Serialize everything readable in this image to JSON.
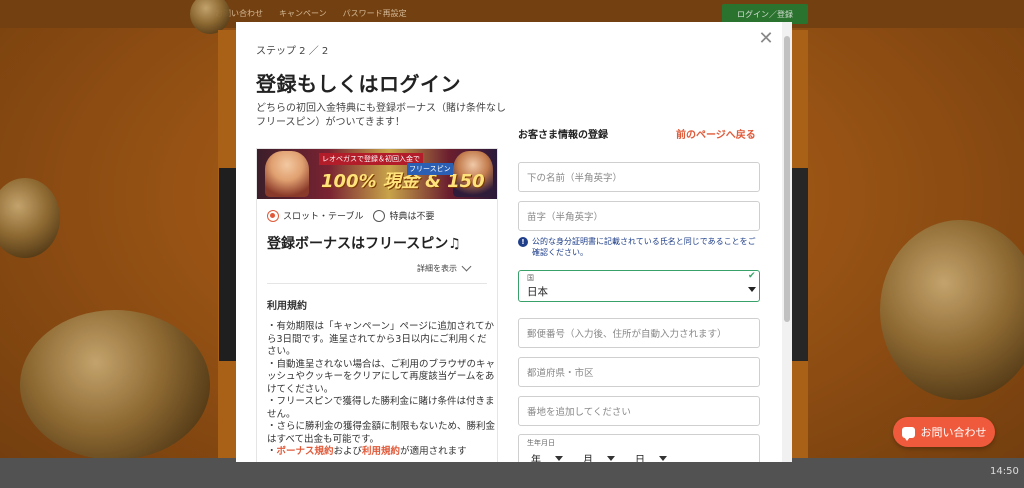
{
  "background": {
    "top_links": [
      "お問い合わせ",
      "キャンペーン",
      "パスワード再設定"
    ],
    "login_button": "ログイン／登録",
    "time": "14:50"
  },
  "modal": {
    "step": "ステップ 2 ／ 2",
    "title": "登録もしくはログイン",
    "description": "どちらの初回入金特典にも登録ボーナス（賭け条件なしフリースピン）がついてきます！",
    "close_icon": "close-icon"
  },
  "bonus_card": {
    "banner": {
      "headline": "レオベガスで登録＆初回入金で",
      "amount": "100% 現金 & 150",
      "sub": "フリースピン"
    },
    "radio_options": [
      {
        "label": "スロット・テーブル",
        "selected": true
      },
      {
        "label": "特典は不要",
        "selected": false
      }
    ],
    "title": "登録ボーナスはフリースピン♫",
    "details_label": "詳細を表示",
    "terms_title": "利用規約",
    "terms": [
      "・有効期限は「キャンペーン」ページに追加されてから3日間です。進呈されてから3日以内にご利用ください。",
      "・自動進呈されない場合は、ご利用のブラウザのキャッシュやクッキーをクリアにして再度該当ゲームをあけてください。",
      "・フリースピンで獲得した勝利金に賭け条件は付きません。",
      "・さらに勝利金の獲得金額に制限もないため、勝利金はすべて出金も可能です。"
    ],
    "terms_last": {
      "prefix": "・",
      "link1": "ボーナス規約",
      "middle": "および",
      "link2": "利用規約",
      "suffix": "が適用されます"
    }
  },
  "form": {
    "heading": "お客さま情報の登録",
    "back_link": "前のページへ戻る",
    "first_name_placeholder": "下の名前（半角英字）",
    "last_name_placeholder": "苗字（半角英字）",
    "name_note": "公的な身分証明書に記載されている氏名と同じであることをご確認ください。",
    "country": {
      "label": "国",
      "value": "日本"
    },
    "postal_placeholder": "郵便番号（入力後、住所が自動入力されます）",
    "city_placeholder": "都道府県・市区",
    "address_placeholder": "番地を追加してください",
    "dob": {
      "label": "生年月日",
      "year": "年",
      "month": "月",
      "day": "日"
    }
  },
  "chat_button": "お問い合わせ",
  "colors": {
    "accent": "#e05a3a",
    "chat": "#f05a3c",
    "valid": "#38a169",
    "note": "#1f3f8a"
  }
}
